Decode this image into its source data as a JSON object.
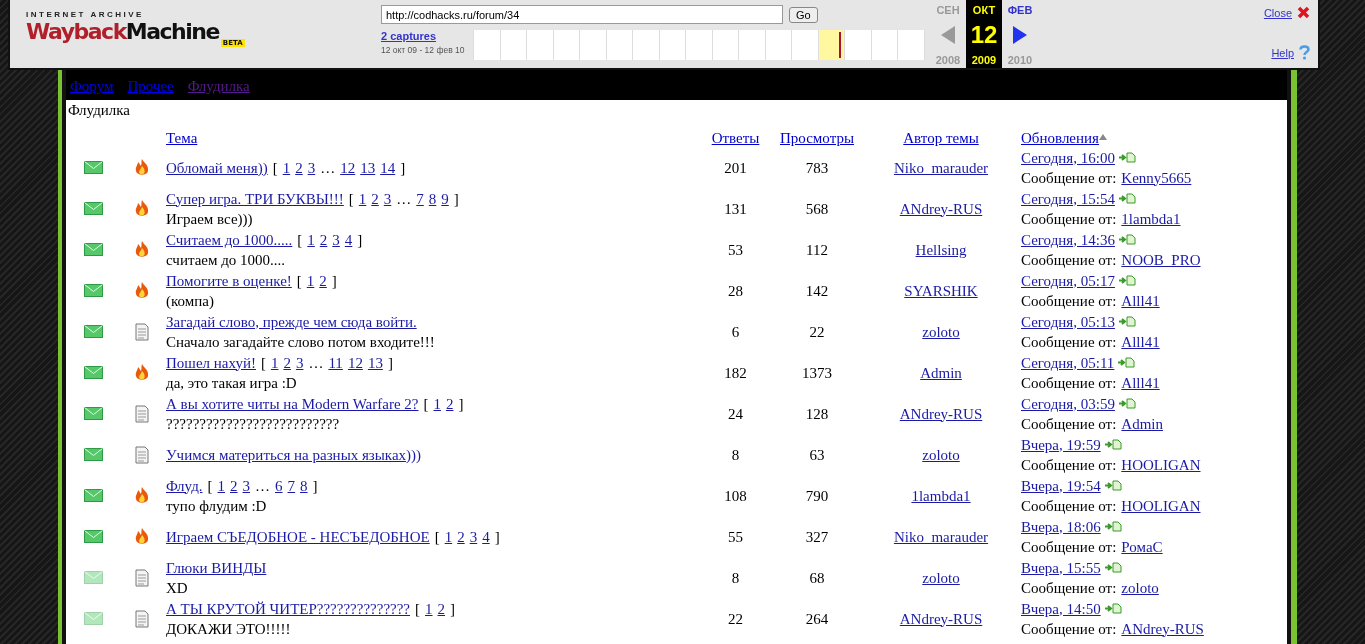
{
  "wayback": {
    "logo": {
      "top": "INTERNET ARCHIVE",
      "main_a": "Wayback",
      "main_b": "Machine",
      "badge": "BETA"
    },
    "url": "http://codhacks.ru/forum/34",
    "go": "Go",
    "captures": "2 captures",
    "range": "12 окт 09 - 12 фев 10",
    "timeline": [
      {
        "highlighted": false
      },
      {
        "highlighted": false
      },
      {
        "highlighted": false
      },
      {
        "highlighted": false
      },
      {
        "highlighted": false
      },
      {
        "highlighted": false
      },
      {
        "highlighted": false
      },
      {
        "highlighted": false
      },
      {
        "highlighted": false
      },
      {
        "highlighted": false
      },
      {
        "highlighted": false
      },
      {
        "highlighted": false
      },
      {
        "highlighted": false
      },
      {
        "highlighted": true
      },
      {
        "highlighted": false
      },
      {
        "highlighted": false
      },
      {
        "highlighted": false
      }
    ],
    "prev": {
      "month": "СЕН",
      "year": "2008",
      "disabled": true
    },
    "current": {
      "month": "ОКТ",
      "day": "12",
      "year": "2009"
    },
    "next": {
      "month": "ФЕВ",
      "year": "2010",
      "disabled": false
    },
    "close": "Close",
    "help": "Help"
  },
  "breadcrumbs": [
    {
      "label": "Форум",
      "visited": false
    },
    {
      "label": "Прочее",
      "visited": false
    },
    {
      "label": "Флудилка",
      "visited": true
    }
  ],
  "forum_title": "Флудилка",
  "columns": [
    {
      "label": "Тема",
      "sorted": false
    },
    {
      "label": "Ответы",
      "sorted": false
    },
    {
      "label": "Просмотры",
      "sorted": false
    },
    {
      "label": "Автор темы",
      "sorted": false
    },
    {
      "label": "Обновления",
      "sorted": true
    }
  ],
  "rows": [
    {
      "unread": true,
      "kind": "hot",
      "title": "Обломай меня))",
      "pages": [
        {
          "kind": "text",
          "label": "["
        },
        {
          "kind": "link",
          "label": "1"
        },
        {
          "kind": "link",
          "label": "2"
        },
        {
          "kind": "link",
          "label": "3"
        },
        {
          "kind": "text",
          "label": "…"
        },
        {
          "kind": "link",
          "label": "12"
        },
        {
          "kind": "link",
          "label": "13"
        },
        {
          "kind": "link",
          "label": "14"
        },
        {
          "kind": "text",
          "label": "]"
        }
      ],
      "replies": "201",
      "views": "783",
      "author": "Niko_marauder",
      "time": "Сегодня, 16:00",
      "by_label": "Сообщение от:",
      "by": "Kenny5665"
    },
    {
      "unread": true,
      "kind": "hot",
      "title": "Супер игра. ТРИ БУКВЫ!!!",
      "pages": [
        {
          "kind": "text",
          "label": "["
        },
        {
          "kind": "link",
          "label": "1"
        },
        {
          "kind": "link",
          "label": "2"
        },
        {
          "kind": "link",
          "label": "3"
        },
        {
          "kind": "text",
          "label": "…"
        },
        {
          "kind": "link",
          "label": "7"
        },
        {
          "kind": "link",
          "label": "8"
        },
        {
          "kind": "link",
          "label": "9"
        },
        {
          "kind": "text",
          "label": "]"
        }
      ],
      "description": "Играем все)))",
      "replies": "131",
      "views": "568",
      "author": "ANdrey-RUS",
      "time": "Сегодня, 15:54",
      "by_label": "Сообщение от:",
      "by": "1lambda1"
    },
    {
      "unread": true,
      "kind": "hot",
      "title": "Считаем до 1000.....",
      "pages": [
        {
          "kind": "text",
          "label": "["
        },
        {
          "kind": "link",
          "label": "1"
        },
        {
          "kind": "link",
          "label": "2"
        },
        {
          "kind": "link",
          "label": "3"
        },
        {
          "kind": "link",
          "label": "4"
        },
        {
          "kind": "text",
          "label": "]"
        }
      ],
      "description": "считаем до 1000....",
      "replies": "53",
      "views": "112",
      "author": "Hellsing",
      "time": "Сегодня, 14:36",
      "by_label": "Сообщение от:",
      "by": "NOOB_PRO"
    },
    {
      "unread": true,
      "kind": "hot",
      "title": "Помогите в оценке!",
      "pages": [
        {
          "kind": "text",
          "label": "["
        },
        {
          "kind": "link",
          "label": "1"
        },
        {
          "kind": "link",
          "label": "2"
        },
        {
          "kind": "text",
          "label": "]"
        }
      ],
      "description": "(компа)",
      "replies": "28",
      "views": "142",
      "author": "SYARSHIK",
      "time": "Сегодня, 05:17",
      "by_label": "Сообщение от:",
      "by": "Alll41"
    },
    {
      "unread": true,
      "kind": "normal",
      "title": "Загадай слово, прежде чем сюда войти.",
      "pages": [],
      "description": "Сначало загадайте слово потом входите!!!",
      "replies": "6",
      "views": "22",
      "author": "zoloto",
      "time": "Сегодня, 05:13",
      "by_label": "Сообщение от:",
      "by": "Alll41"
    },
    {
      "unread": true,
      "kind": "hot",
      "title": "Пошел нахуй!",
      "pages": [
        {
          "kind": "text",
          "label": "["
        },
        {
          "kind": "link",
          "label": "1"
        },
        {
          "kind": "link",
          "label": "2"
        },
        {
          "kind": "link",
          "label": "3"
        },
        {
          "kind": "text",
          "label": "…"
        },
        {
          "kind": "link",
          "label": "11"
        },
        {
          "kind": "link",
          "label": "12"
        },
        {
          "kind": "link",
          "label": "13"
        },
        {
          "kind": "text",
          "label": "]"
        }
      ],
      "description": "да, это такая игра :D",
      "replies": "182",
      "views": "1373",
      "author": "Admin",
      "time": "Сегодня, 05:11",
      "by_label": "Сообщение от:",
      "by": "Alll41"
    },
    {
      "unread": true,
      "kind": "normal",
      "title": "А вы хотите читы на Modern Warfare 2?",
      "pages": [
        {
          "kind": "text",
          "label": "["
        },
        {
          "kind": "link",
          "label": "1"
        },
        {
          "kind": "link",
          "label": "2"
        },
        {
          "kind": "text",
          "label": "]"
        }
      ],
      "description": "??????????????????????????",
      "replies": "24",
      "views": "128",
      "author": "ANdrey-RUS",
      "time": "Сегодня, 03:59",
      "by_label": "Сообщение от:",
      "by": "Admin"
    },
    {
      "unread": true,
      "kind": "normal",
      "title": "Учимся материться на разных языках)))",
      "pages": [],
      "replies": "8",
      "views": "63",
      "author": "zoloto",
      "time": "Вчера, 19:59",
      "by_label": "Сообщение от:",
      "by": "HOOLIGAN"
    },
    {
      "unread": true,
      "kind": "hot",
      "title": "Флуд.",
      "pages": [
        {
          "kind": "text",
          "label": "["
        },
        {
          "kind": "link",
          "label": "1"
        },
        {
          "kind": "link",
          "label": "2"
        },
        {
          "kind": "link",
          "label": "3"
        },
        {
          "kind": "text",
          "label": "…"
        },
        {
          "kind": "link",
          "label": "6"
        },
        {
          "kind": "link",
          "label": "7"
        },
        {
          "kind": "link",
          "label": "8"
        },
        {
          "kind": "text",
          "label": "]"
        }
      ],
      "description": "тупо флудим :D",
      "replies": "108",
      "views": "790",
      "author": "1lambda1",
      "time": "Вчера, 19:54",
      "by_label": "Сообщение от:",
      "by": "HOOLIGAN"
    },
    {
      "unread": true,
      "kind": "hot",
      "title": "Играем СЪЕДОБНОЕ - НЕСЪЕДОБНОЕ",
      "pages": [
        {
          "kind": "text",
          "label": "["
        },
        {
          "kind": "link",
          "label": "1"
        },
        {
          "kind": "link",
          "label": "2"
        },
        {
          "kind": "link",
          "label": "3"
        },
        {
          "kind": "link",
          "label": "4"
        },
        {
          "kind": "text",
          "label": "]"
        }
      ],
      "replies": "55",
      "views": "327",
      "author": "Niko_marauder",
      "time": "Вчера, 18:06",
      "by_label": "Сообщение от:",
      "by": "РомаС"
    },
    {
      "unread": false,
      "kind": "normal",
      "title": "Глюки ВИНДЫ",
      "pages": [],
      "description": "XD",
      "replies": "8",
      "views": "68",
      "author": "zoloto",
      "time": "Вчера, 15:55",
      "by_label": "Сообщение от:",
      "by": "zoloto"
    },
    {
      "unread": false,
      "kind": "normal",
      "title": "А ТЫ КРУТОЙ ЧИТЕР??????????????",
      "pages": [
        {
          "kind": "text",
          "label": "["
        },
        {
          "kind": "link",
          "label": "1"
        },
        {
          "kind": "link",
          "label": "2"
        },
        {
          "kind": "text",
          "label": "]"
        }
      ],
      "description": "ДОКАЖИ ЭТО!!!!!",
      "replies": "22",
      "views": "264",
      "author": "ANdrey-RUS",
      "time": "Вчера, 14:50",
      "by_label": "Сообщение от:",
      "by": "ANdrey-RUS"
    }
  ]
}
